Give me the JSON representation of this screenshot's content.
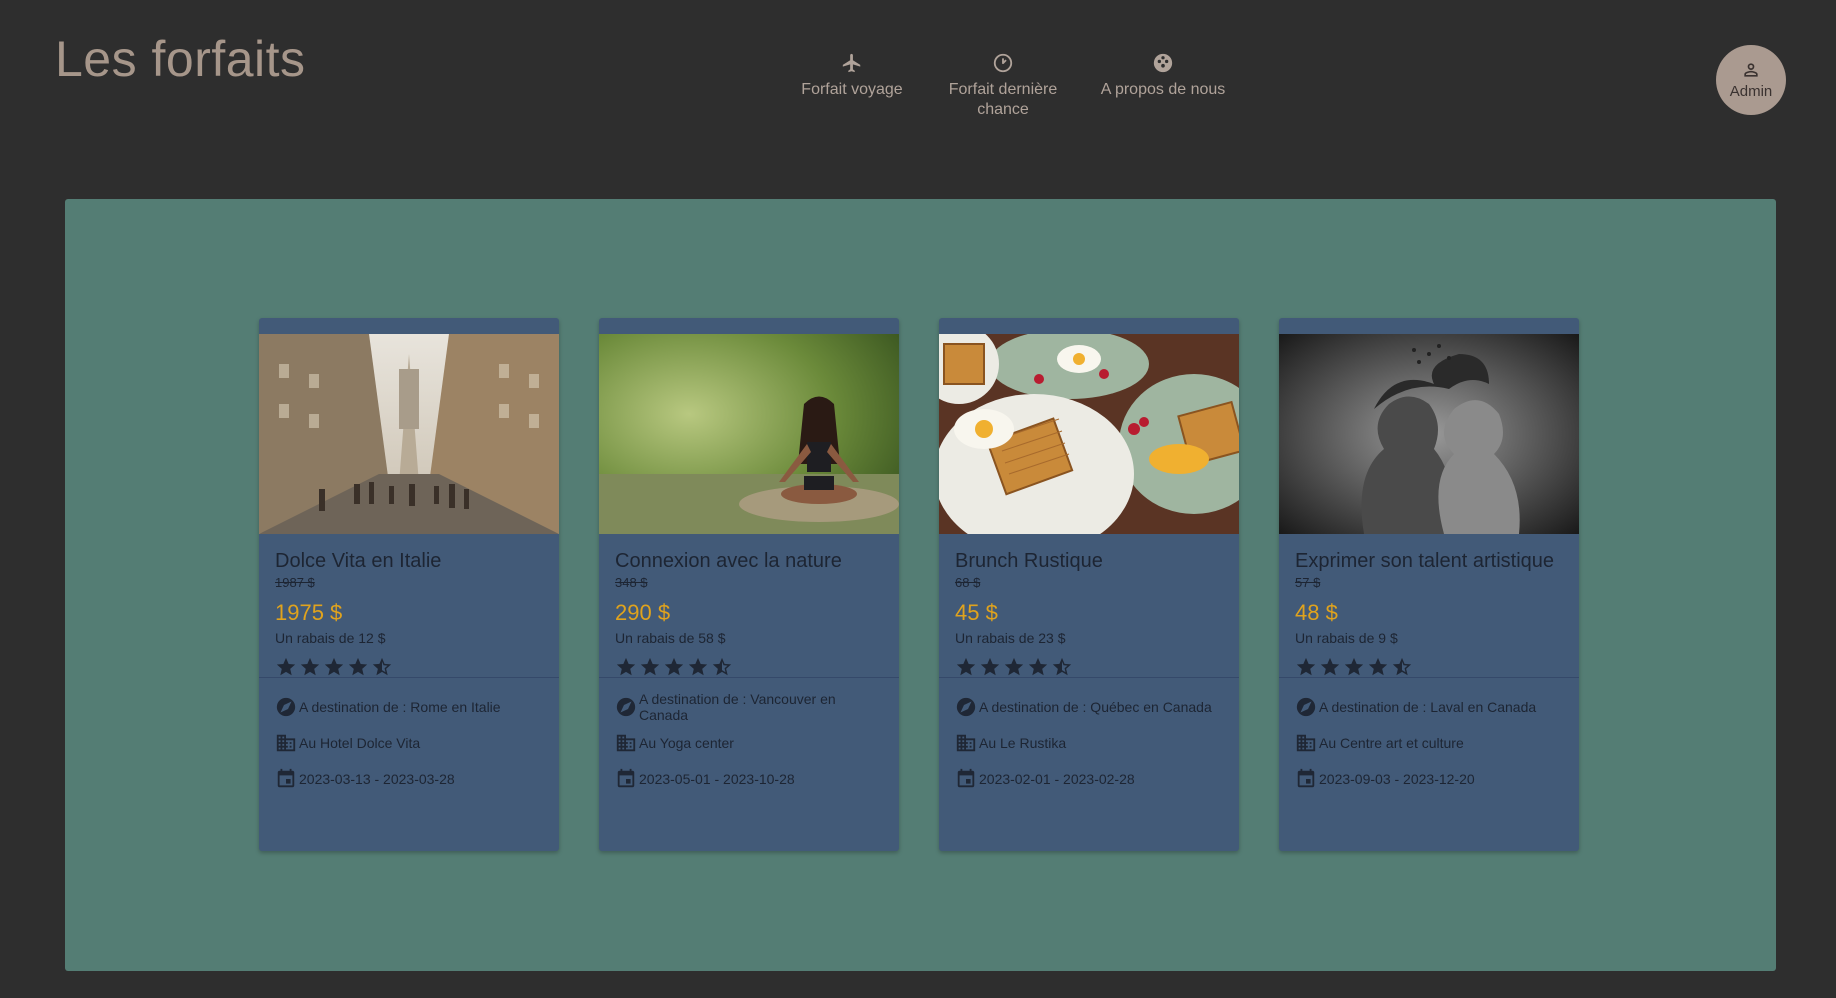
{
  "header": {
    "title": "Les forfaits",
    "nav": [
      {
        "label": "Forfait voyage",
        "icon": "airplane-icon"
      },
      {
        "label": "Forfait dernière chance",
        "icon": "timer-icon"
      },
      {
        "label": "A propos de nous",
        "icon": "group-icon"
      }
    ],
    "admin_label": "Admin"
  },
  "colors": {
    "background": "#2e2e2e",
    "panel": "#547d74",
    "card": "#425a78",
    "price": "#e0a31d",
    "title_text": "#a6968a"
  },
  "cards": [
    {
      "title": "Dolce Vita en Italie",
      "old_price": "1987 $",
      "price": "1975 $",
      "discount": "Un rabais de 12 $",
      "rating": 4.5,
      "destination": "A destination de : Rome en Italie",
      "hotel": "Au Hotel Dolce Vita",
      "dates": "2023-03-13 - 2023-03-28",
      "image": "city-street-photo"
    },
    {
      "title": "Connexion avec la nature",
      "old_price": "348 $",
      "price": "290 $",
      "discount": "Un rabais de 58 $",
      "rating": 4.5,
      "destination": "A destination de : Vancouver en Canada",
      "hotel": "Au Yoga center",
      "dates": "2023-05-01 - 2023-10-28",
      "image": "yoga-nature-photo"
    },
    {
      "title": "Brunch Rustique",
      "old_price": "68 $",
      "price": "45 $",
      "discount": "Un rabais de 23 $",
      "rating": 4.5,
      "destination": "A destination de : Québec en Canada",
      "hotel": "Au Le Rustika",
      "dates": "2023-02-01 - 2023-02-28",
      "image": "waffles-brunch-photo"
    },
    {
      "title": "Exprimer son talent artistique",
      "old_price": "57 $",
      "price": "48 $",
      "discount": "Un rabais de 9 $",
      "rating": 4.5,
      "destination": "A destination de : Laval en Canada",
      "hotel": "Au Centre art et culture",
      "dates": "2023-09-03 - 2023-12-20",
      "image": "artistic-portrait-photo"
    }
  ]
}
